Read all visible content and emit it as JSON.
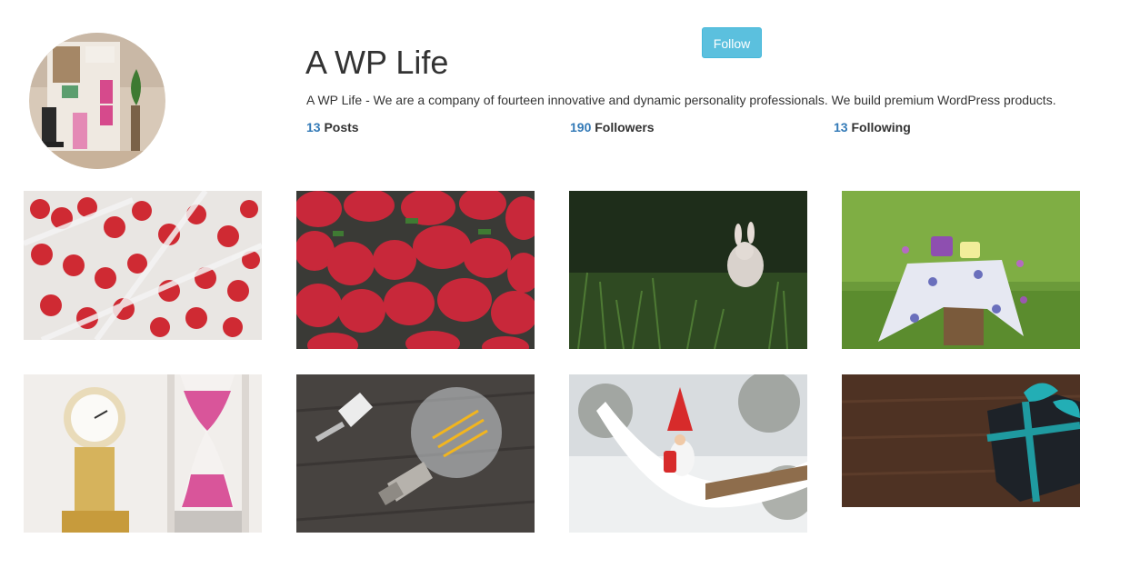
{
  "profile": {
    "name": "A WP Life",
    "bio": "A WP Life - We are a company of fourteen innovative and dynamic personality professionals. We build premium WordPress products.",
    "follow_label": "Follow",
    "accent_color": "#5bc0de",
    "link_color": "#337ab7"
  },
  "stats": {
    "posts": {
      "count": "13",
      "label": "Posts"
    },
    "followers": {
      "count": "190",
      "label": "Followers"
    },
    "following": {
      "count": "13",
      "label": "Following"
    }
  },
  "photos": [
    {
      "subject": "strawberries in boxes"
    },
    {
      "subject": "strawberries close-up"
    },
    {
      "subject": "rabbit in grass"
    },
    {
      "subject": "tea cups on tree stump"
    },
    {
      "subject": "clock and hourglass"
    },
    {
      "subject": "light bulb and plug"
    },
    {
      "subject": "gnome on snowy branch"
    },
    {
      "subject": "gift box on wood"
    }
  ]
}
